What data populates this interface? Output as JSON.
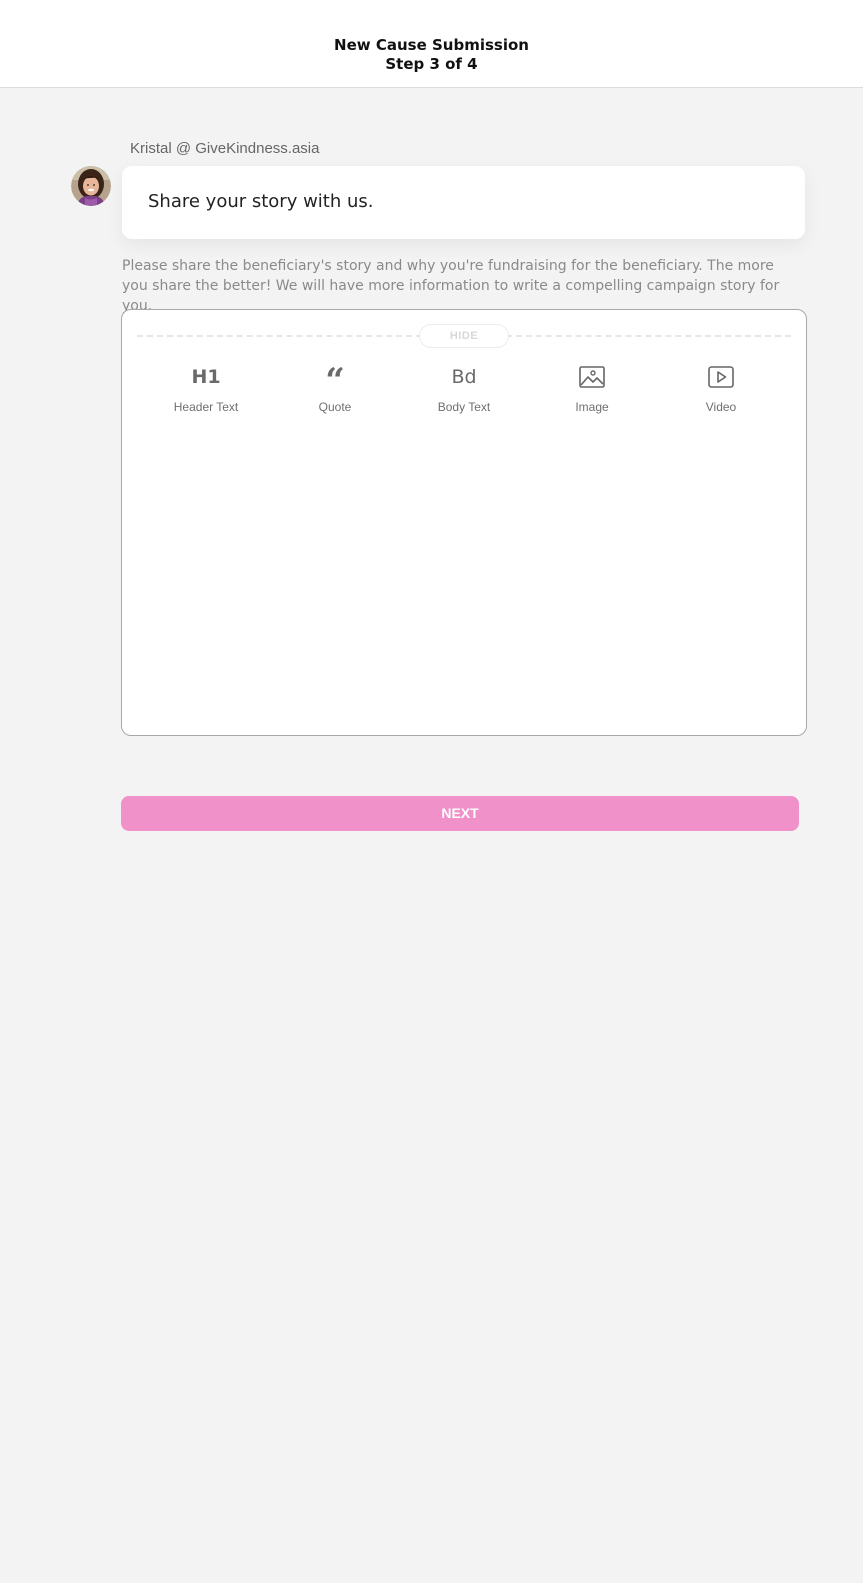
{
  "header": {
    "title": "New Cause Submission",
    "step": "Step 3 of 4"
  },
  "chat": {
    "sender": "Kristal @ GiveKindness.asia",
    "message": "Share your story with us.",
    "avatar_icon": "avatar-photo"
  },
  "description": "Please share the beneficiary's story and why you're fundraising for the beneficiary. The more you share the better! We will have more information to write a compelling campaign story for you.",
  "editor": {
    "hide_label": "HIDE",
    "tools": [
      {
        "glyph": "H1",
        "label": "Header Text",
        "icon": "header-icon"
      },
      {
        "glyph": "“",
        "label": "Quote",
        "icon": "quote-icon"
      },
      {
        "glyph": "Bd",
        "label": "Body Text",
        "icon": "body-text-icon"
      },
      {
        "glyph": "",
        "label": "Image",
        "icon": "image-icon"
      },
      {
        "glyph": "",
        "label": "Video",
        "icon": "video-icon"
      }
    ]
  },
  "next_button": {
    "label": "NEXT"
  },
  "colors": {
    "accent": "#f092c9",
    "background": "#f3f3f3"
  }
}
